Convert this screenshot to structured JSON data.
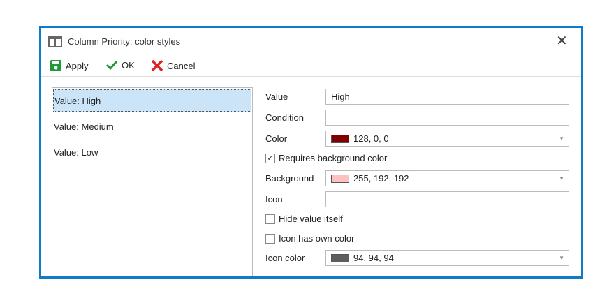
{
  "title": "Column Priority: color styles",
  "toolbar": {
    "apply": "Apply",
    "ok": "OK",
    "cancel": "Cancel"
  },
  "list": [
    {
      "label": "Value: High",
      "selected": true
    },
    {
      "label": "Value: Medium"
    },
    {
      "label": "Value: Low"
    }
  ],
  "form": {
    "value_label": "Value",
    "value": "High",
    "condition_label": "Condition",
    "condition": "",
    "color_label": "Color",
    "color": "128, 0, 0",
    "color_hex": "#800000",
    "requires_bg_label": "Requires background color",
    "requires_bg": true,
    "background_label": "Background",
    "background": "255, 192, 192",
    "background_hex": "#ffc0c0",
    "icon_label": "Icon",
    "icon": "",
    "hide_value_label": "Hide value itself",
    "hide_value": false,
    "icon_own_color_label": "Icon has own color",
    "icon_own_color": false,
    "icon_color_label": "Icon color",
    "icon_color": "94, 94, 94",
    "icon_color_hex": "#5e5e5e"
  }
}
